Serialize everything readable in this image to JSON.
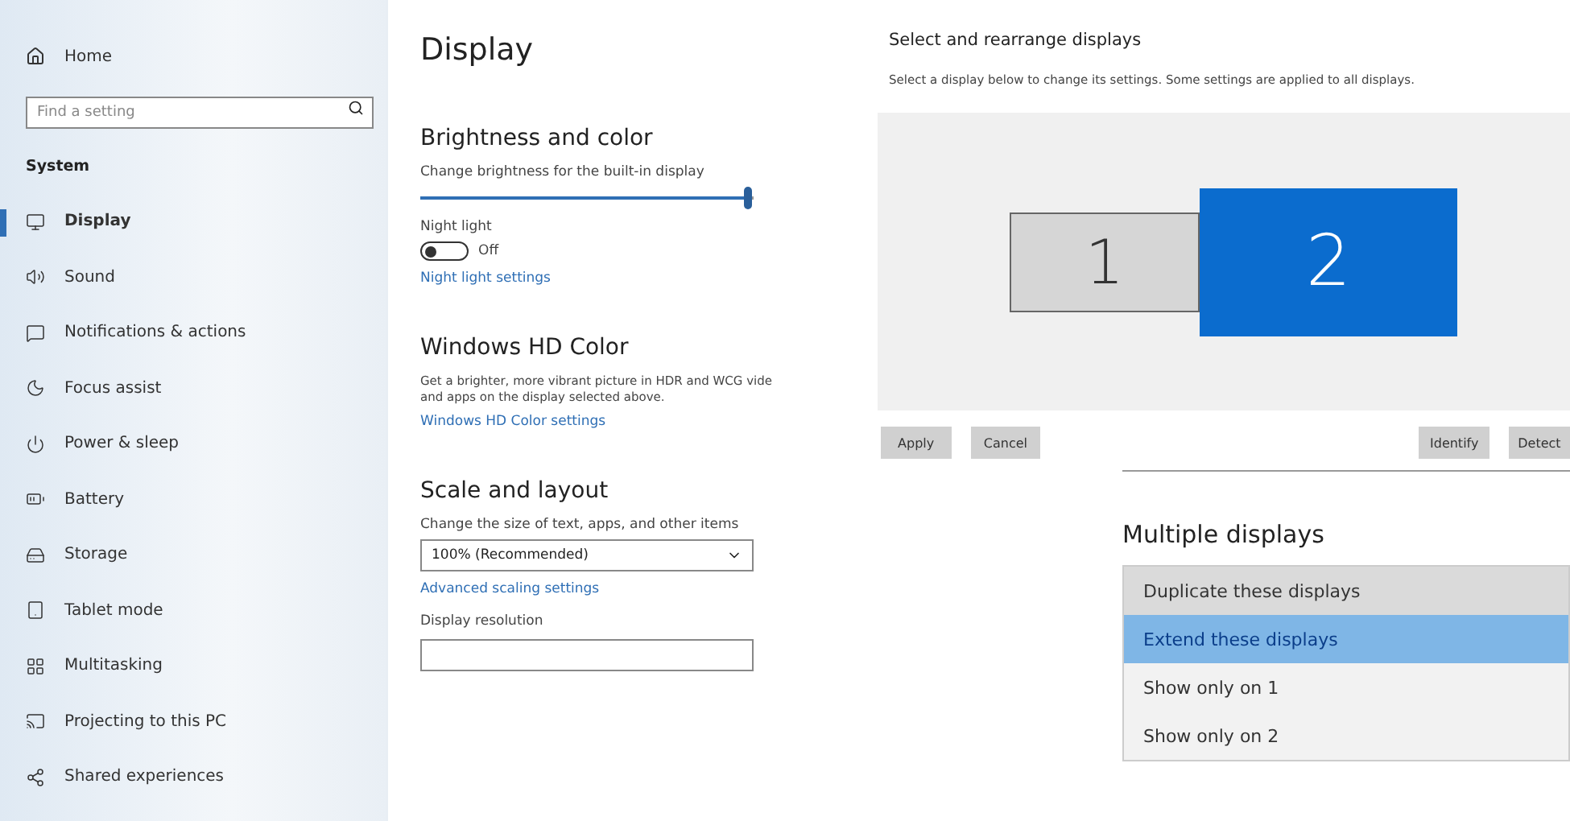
{
  "sidebar": {
    "home": "Home",
    "search": {
      "placeholder": "Find a setting"
    },
    "section": "System",
    "items": [
      {
        "label": "Display",
        "selected": true
      },
      {
        "label": "Sound",
        "selected": false
      },
      {
        "label": "Notifications & actions",
        "selected": false
      },
      {
        "label": "Focus assist",
        "selected": false
      },
      {
        "label": "Power & sleep",
        "selected": false
      },
      {
        "label": "Battery",
        "selected": false
      },
      {
        "label": "Storage",
        "selected": false
      },
      {
        "label": "Tablet mode",
        "selected": false
      },
      {
        "label": "Multitasking",
        "selected": false
      },
      {
        "label": "Projecting to this PC",
        "selected": false
      },
      {
        "label": "Shared experiences",
        "selected": false
      }
    ]
  },
  "display": {
    "title": "Display",
    "brightness": {
      "heading": "Brightness and color",
      "label": "Change brightness for the built-in display",
      "level": 0.98
    },
    "night_light": {
      "label": "Night light",
      "on": false,
      "state_text": "Off",
      "link": "Night light settings"
    },
    "hd_color": {
      "heading": "Windows HD Color",
      "lines": [
        "Get a brighter, more vibrant picture in HDR and WCG vide",
        "and apps on the display selected above."
      ],
      "link": "Windows HD Color settings"
    },
    "scale": {
      "heading": "Scale and layout",
      "label": "Change the size of text, apps, and other items",
      "value": "100% (Recommended)",
      "link": "Advanced scaling settings",
      "resolution_label": "Display resolution"
    }
  },
  "arrange": {
    "heading": "Select and rearrange displays",
    "description": "Select a display below to change its settings. Some settings are applied to all displays.",
    "monitors": [
      {
        "label": "1",
        "selected": false
      },
      {
        "label": "2",
        "selected": true
      }
    ],
    "buttons": [
      "Apply",
      "Cancel",
      "Identify",
      "Detect"
    ]
  },
  "multiple_displays": {
    "heading": "Multiple displays",
    "options": [
      {
        "label": "Duplicate these displays",
        "selected": false,
        "hovered": true
      },
      {
        "label": "Extend these displays",
        "selected": true,
        "hovered": false
      },
      {
        "label": "Show only on 1",
        "selected": false,
        "hovered": false
      },
      {
        "label": "Show only on 2",
        "selected": false,
        "hovered": false
      }
    ]
  }
}
